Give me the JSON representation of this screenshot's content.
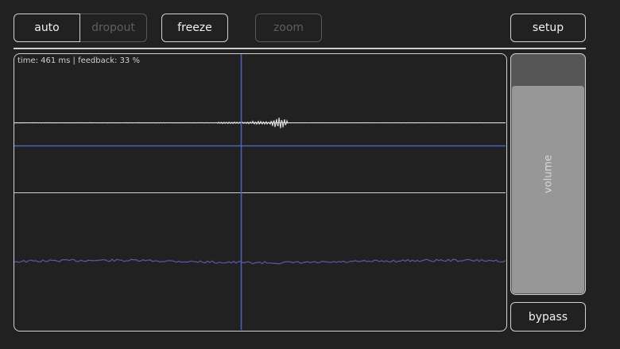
{
  "toolbar": {
    "auto_label": "auto",
    "dropout_label": "dropout",
    "freeze_label": "freeze",
    "zoom_label": "zoom",
    "setup_label": "setup"
  },
  "scope": {
    "readout": "time: 461 ms | feedback: 33 %"
  },
  "volume": {
    "label": "volume",
    "level": 0.87
  },
  "bypass_label": "bypass",
  "colors": {
    "background": "#212121",
    "outline": "#d0d0d0",
    "cursor_blue": "#4a62b8",
    "lower_trace": "#5a5aa6",
    "slider_fill": "#979797",
    "slider_track": "#565656"
  }
}
